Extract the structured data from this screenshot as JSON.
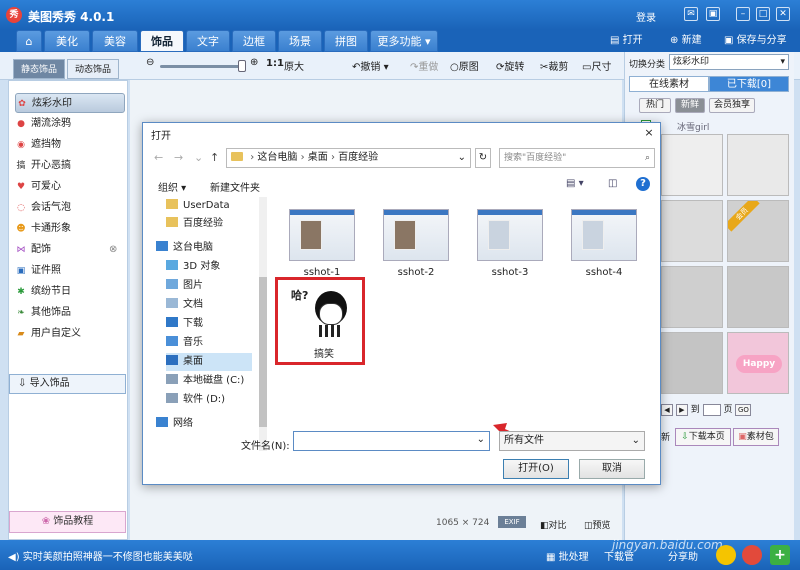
{
  "app": {
    "logo": "秀",
    "title": "美图秀秀 4.0.1",
    "login": "登录"
  },
  "tabs": [
    "美化",
    "美容",
    "饰品",
    "文字",
    "边框",
    "场景",
    "拼图",
    "更多功能"
  ],
  "top_buttons": {
    "open": "打开",
    "new": "新建",
    "save": "保存与分享"
  },
  "toolbar": {
    "zoom_ratio": "1:1",
    "original_size": "原大",
    "undo": "撤销",
    "redo": "重做",
    "original": "原图",
    "rotate": "旋转",
    "crop": "裁剪",
    "resize": "尺寸"
  },
  "left": {
    "subtabs": [
      "静态饰品",
      "动态饰品"
    ],
    "items": [
      "炫彩水印",
      "潮流涂鸦",
      "遮挡物",
      "开心恶搞",
      "可爱心",
      "会话气泡",
      "卡通形象",
      "配饰",
      "证件照",
      "缤纷节日",
      "其他饰品",
      "用户自定义"
    ],
    "import": "导入饰品",
    "tutorial": "饰品教程"
  },
  "right": {
    "switch_label": "切换分类",
    "switch_value": "炫彩水印",
    "tabs": [
      "在线素材",
      "已下载[0]"
    ],
    "chips": [
      "热门",
      "新鲜",
      "会员独享"
    ],
    "hint": "冰雪girl",
    "badge": "会员",
    "happy": "Happy",
    "pager_to": "到",
    "pager_page": "页",
    "pager_go": "GO",
    "download_page": "下载本页",
    "material_lib": "素材包",
    "new_frag": "新"
  },
  "canvas": {
    "size": "1065 × 724",
    "exif": "EXIF",
    "compare": "对比",
    "preview": "预览"
  },
  "status": {
    "tip": "实时美颜拍照神器一不修图也能美美哒",
    "batch": "批处理",
    "download_frag": "下载管",
    "share_frag": "分享助",
    "watermark": "jingyan.baidu.com"
  },
  "dialog": {
    "title": "打开",
    "close": "×",
    "breadcrumb": [
      "这台电脑",
      "桌面",
      "百度经验"
    ],
    "search_placeholder": "搜索\"百度经验\"",
    "organize": "组织",
    "new_folder": "新建文件夹",
    "nav_items": [
      "UserData",
      "百度经验",
      "这台电脑",
      "3D 对象",
      "图片",
      "文档",
      "下载",
      "音乐",
      "桌面",
      "本地磁盘 (C:)",
      "软件 (D:)",
      "网络"
    ],
    "files": [
      "sshot-1",
      "sshot-2",
      "sshot-3",
      "sshot-4",
      "搞笑"
    ],
    "face_text": "哈?",
    "filename_label": "文件名(N):",
    "filetype": "所有文件",
    "open": "打开(O)",
    "cancel": "取消"
  }
}
